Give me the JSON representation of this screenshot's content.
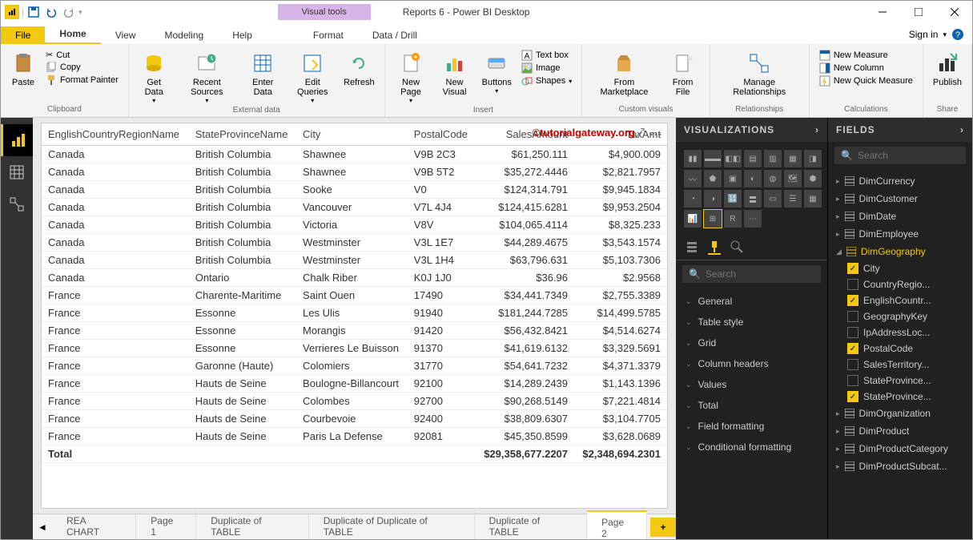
{
  "window": {
    "title": "Reports 6 - Power BI Desktop",
    "visual_tools": "Visual tools",
    "sign_in": "Sign in"
  },
  "tabs": {
    "file": "File",
    "home": "Home",
    "view": "View",
    "modeling": "Modeling",
    "help": "Help",
    "format": "Format",
    "datadrill": "Data / Drill"
  },
  "ribbon": {
    "clipboard": {
      "title": "Clipboard",
      "paste": "Paste",
      "cut": "Cut",
      "copy": "Copy",
      "format_painter": "Format Painter"
    },
    "external": {
      "title": "External data",
      "get_data": "Get Data",
      "recent": "Recent Sources",
      "enter": "Enter Data",
      "edit_q": "Edit Queries",
      "refresh": "Refresh"
    },
    "insert": {
      "title": "Insert",
      "new_page": "New Page",
      "new_visual": "New Visual",
      "buttons": "Buttons",
      "textbox": "Text box",
      "image": "Image",
      "shapes": "Shapes"
    },
    "custom": {
      "title": "Custom visuals",
      "marketplace": "From Marketplace",
      "file": "From File"
    },
    "rel": {
      "title": "Relationships",
      "manage": "Manage Relationships"
    },
    "calc": {
      "title": "Calculations",
      "measure": "New Measure",
      "column": "New Column",
      "quick": "New Quick Measure"
    },
    "share": {
      "title": "Share",
      "publish": "Publish"
    }
  },
  "watermark": "©tutorialgateway.org",
  "chart_data": {
    "type": "table",
    "columns": [
      "EnglishCountryRegionName",
      "StateProvinceName",
      "City",
      "PostalCode",
      "SalesAmount",
      "TaxAmt"
    ],
    "rows": [
      [
        "Canada",
        "British Columbia",
        "Shawnee",
        "V9B 2C3",
        "$61,250.111",
        "$4,900.009"
      ],
      [
        "Canada",
        "British Columbia",
        "Shawnee",
        "V9B 5T2",
        "$35,272.4446",
        "$2,821.7957"
      ],
      [
        "Canada",
        "British Columbia",
        "Sooke",
        "V0",
        "$124,314.791",
        "$9,945.1834"
      ],
      [
        "Canada",
        "British Columbia",
        "Vancouver",
        "V7L 4J4",
        "$124,415.6281",
        "$9,953.2504"
      ],
      [
        "Canada",
        "British Columbia",
        "Victoria",
        "V8V",
        "$104,065.4114",
        "$8,325.233"
      ],
      [
        "Canada",
        "British Columbia",
        "Westminster",
        "V3L 1E7",
        "$44,289.4675",
        "$3,543.1574"
      ],
      [
        "Canada",
        "British Columbia",
        "Westminster",
        "V3L 1H4",
        "$63,796.631",
        "$5,103.7306"
      ],
      [
        "Canada",
        "Ontario",
        "Chalk Riber",
        "K0J 1J0",
        "$36.96",
        "$2.9568"
      ],
      [
        "France",
        "Charente-Maritime",
        "Saint Ouen",
        "17490",
        "$34,441.7349",
        "$2,755.3389"
      ],
      [
        "France",
        "Essonne",
        "Les Ulis",
        "91940",
        "$181,244.7285",
        "$14,499.5785"
      ],
      [
        "France",
        "Essonne",
        "Morangis",
        "91420",
        "$56,432.8421",
        "$4,514.6274"
      ],
      [
        "France",
        "Essonne",
        "Verrieres Le Buisson",
        "91370",
        "$41,619.6132",
        "$3,329.5691"
      ],
      [
        "France",
        "Garonne (Haute)",
        "Colomiers",
        "31770",
        "$54,641.7232",
        "$4,371.3379"
      ],
      [
        "France",
        "Hauts de Seine",
        "Boulogne-Billancourt",
        "92100",
        "$14,289.2439",
        "$1,143.1396"
      ],
      [
        "France",
        "Hauts de Seine",
        "Colombes",
        "92700",
        "$90,268.5149",
        "$7,221.4814"
      ],
      [
        "France",
        "Hauts de Seine",
        "Courbevoie",
        "92400",
        "$38,809.6307",
        "$3,104.7705"
      ],
      [
        "France",
        "Hauts de Seine",
        "Paris La Defense",
        "92081",
        "$45,350.8599",
        "$3,628.0689"
      ]
    ],
    "total_label": "Total",
    "totals": [
      "$29,358,677.2207",
      "$2,348,694.2301"
    ]
  },
  "page_tabs": [
    "REA CHART",
    "Page 1",
    "Duplicate of TABLE",
    "Duplicate of Duplicate of TABLE",
    "Duplicate of TABLE",
    "Page 2"
  ],
  "viz_panel": {
    "title": "VISUALIZATIONS",
    "search": "Search",
    "sections": [
      "General",
      "Table style",
      "Grid",
      "Column headers",
      "Values",
      "Total",
      "Field formatting",
      "Conditional formatting"
    ]
  },
  "fields_panel": {
    "title": "FIELDS",
    "search": "Search",
    "tables": [
      "DimCurrency",
      "DimCustomer",
      "DimDate",
      "DimEmployee"
    ],
    "expanded_table": "DimGeography",
    "fields": [
      {
        "name": "City",
        "checked": true
      },
      {
        "name": "CountryRegio...",
        "checked": false
      },
      {
        "name": "EnglishCountr...",
        "checked": true
      },
      {
        "name": "GeographyKey",
        "checked": false
      },
      {
        "name": "IpAddressLoc...",
        "checked": false
      },
      {
        "name": "PostalCode",
        "checked": true
      },
      {
        "name": "SalesTerritory...",
        "checked": false
      },
      {
        "name": "StateProvince...",
        "checked": false
      },
      {
        "name": "StateProvince...",
        "checked": true
      }
    ],
    "tables_after": [
      "DimOrganization",
      "DimProduct",
      "DimProductCategory",
      "DimProductSubcat..."
    ]
  }
}
